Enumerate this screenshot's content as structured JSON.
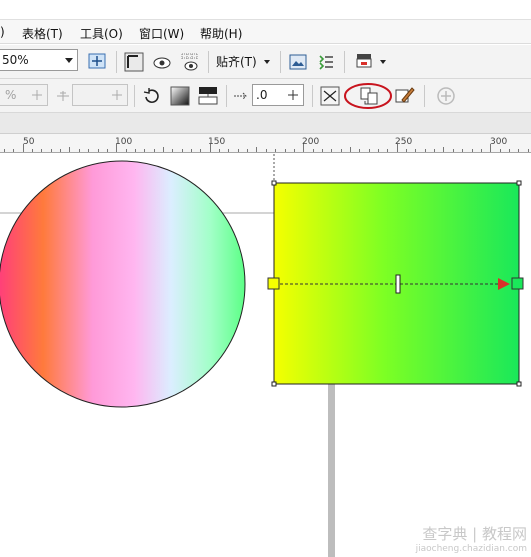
{
  "menu": {
    "items": [
      {
        "label": ")"
      },
      {
        "label": "表格(T)"
      },
      {
        "label": "工具(O)"
      },
      {
        "label": "窗口(W)"
      },
      {
        "label": "帮助(H)"
      }
    ]
  },
  "toolbar1": {
    "zoom_value": "50%",
    "snap_label": "贴齐(T)",
    "icons": [
      "zoom-to-page-icon",
      "frame-icon",
      "view-eye-icon",
      "view-grid-eye-icon",
      "image-icon",
      "list-icon",
      "launch-icon"
    ]
  },
  "toolbar2": {
    "opacity_value": "%",
    "nudge_value": ".0",
    "icons": [
      "rotate-icon",
      "fill-gradient-icon",
      "swap-icon",
      "copy-properties-icon",
      "mirror-icon",
      "edit-fill-icon",
      "add-icon"
    ]
  },
  "ruler": {
    "labels": [
      "50",
      "100",
      "150",
      "200",
      "250",
      "300"
    ]
  },
  "highlight": {
    "color": "#c8141e"
  },
  "watermark": {
    "line1": "查字典 | 教程网",
    "line2": "jiaocheng.chazidian.com"
  },
  "canvas": {
    "circle_gradient": [
      "#ff3f7a",
      "#ff7a3c",
      "#ff9ad8",
      "#ffb6f0",
      "#dbeeff",
      "#a2ffc8",
      "#5cff86"
    ],
    "rect_gradient": [
      "#f5ff00",
      "#7dff24",
      "#1ae85a"
    ]
  }
}
